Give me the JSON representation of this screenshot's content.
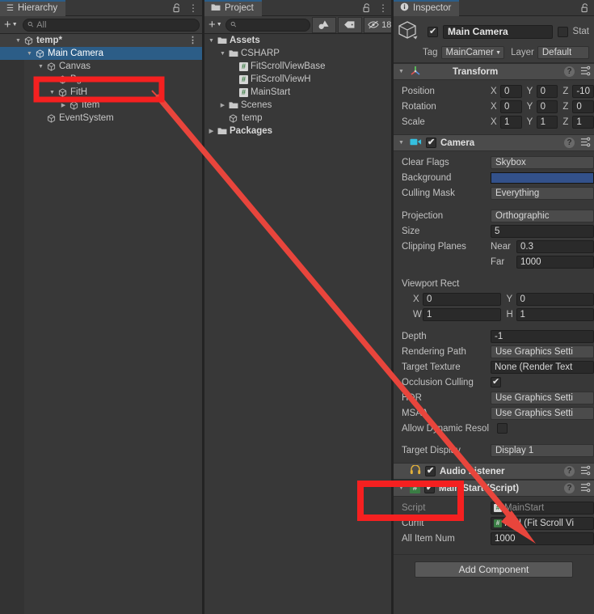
{
  "hierarchy": {
    "tab_label": "Hierarchy",
    "tab_icon": "hierarchy-icon",
    "lock_icon": "lock-open-icon",
    "menu_icon": "kebab-menu-icon",
    "add_label": "+",
    "search_placeholder": "All",
    "scene_name": "temp*",
    "items": [
      {
        "label": "Main Camera",
        "depth": 1,
        "twisty": "open",
        "icon": "gameobject-icon",
        "selected": true
      },
      {
        "label": "Canvas",
        "depth": 2,
        "twisty": "open",
        "icon": "gameobject-icon",
        "selected": false
      },
      {
        "label": "Bg",
        "depth": 3,
        "twisty": "none",
        "icon": "gameobject-icon",
        "selected": false
      },
      {
        "label": "FitH",
        "depth": 3,
        "twisty": "open",
        "icon": "gameobject-icon",
        "selected": false
      },
      {
        "label": "Item",
        "depth": 4,
        "twisty": "closed",
        "icon": "gameobject-icon",
        "selected": false
      },
      {
        "label": "EventSystem",
        "depth": 2,
        "twisty": "none",
        "icon": "gameobject-icon",
        "selected": false
      }
    ]
  },
  "project": {
    "tab_label": "Project",
    "tab_icon": "folder-icon",
    "lock_icon": "lock-open-icon",
    "menu_icon": "kebab-menu-icon",
    "add_label": "+",
    "search_placeholder": "",
    "toolbar_icons": [
      "shapes-filter-icon",
      "label-filter-icon",
      "hidden-count-icon"
    ],
    "hidden_count": "18",
    "items": [
      {
        "label": "Assets",
        "depth": 0,
        "twisty": "open",
        "kind": "folder",
        "bold": true
      },
      {
        "label": "CSHARP",
        "depth": 1,
        "twisty": "open",
        "kind": "folder",
        "bold": false
      },
      {
        "label": "FitScrollViewBase",
        "depth": 2,
        "twisty": "none",
        "kind": "script",
        "bold": false
      },
      {
        "label": "FitScrollViewH",
        "depth": 2,
        "twisty": "none",
        "kind": "script",
        "bold": false
      },
      {
        "label": "MainStart",
        "depth": 2,
        "twisty": "none",
        "kind": "script",
        "bold": false
      },
      {
        "label": "Scenes",
        "depth": 1,
        "twisty": "closed",
        "kind": "folder",
        "bold": false
      },
      {
        "label": "temp",
        "depth": 2,
        "twisty": "none",
        "kind": "scene",
        "bold": false
      },
      {
        "label": "Packages",
        "depth": 0,
        "twisty": "closed",
        "kind": "folder",
        "bold": true
      }
    ]
  },
  "inspector": {
    "tab_label": "Inspector",
    "tab_icon": "info-icon",
    "lock_icon": "lock-open-icon",
    "gameobject": {
      "enabled": true,
      "name": "Main Camera",
      "static_label": "Stat",
      "tag_label": "Tag",
      "tag_value": "MainCamer",
      "layer_label": "Layer",
      "layer_value": "Default"
    },
    "transform": {
      "title": "Transform",
      "icon": "transform-icon",
      "rows": [
        {
          "label": "Position",
          "x": "0",
          "y": "0",
          "z": "-10"
        },
        {
          "label": "Rotation",
          "x": "0",
          "y": "0",
          "z": "0"
        },
        {
          "label": "Scale",
          "x": "1",
          "y": "1",
          "z": "1"
        }
      ]
    },
    "camera": {
      "title": "Camera",
      "icon": "camera-icon",
      "enabled": true,
      "clear_flags_label": "Clear Flags",
      "clear_flags_value": "Skybox",
      "background_label": "Background",
      "background_color": "#33518a",
      "culling_mask_label": "Culling Mask",
      "culling_mask_value": "Everything",
      "projection_label": "Projection",
      "projection_value": "Orthographic",
      "size_label": "Size",
      "size_value": "5",
      "clipping_label": "Clipping Planes",
      "near_label": "Near",
      "near_value": "0.3",
      "far_label": "Far",
      "far_value": "1000",
      "viewport_label": "Viewport Rect",
      "viewport_x_label": "X",
      "viewport_x": "0",
      "viewport_y_label": "Y",
      "viewport_y": "0",
      "viewport_w_label": "W",
      "viewport_w": "1",
      "viewport_h_label": "H",
      "viewport_h": "1",
      "depth_label": "Depth",
      "depth_value": "-1",
      "rendering_path_label": "Rendering Path",
      "rendering_path_value": "Use Graphics Setti",
      "target_texture_label": "Target Texture",
      "target_texture_value": "None (Render Text",
      "occlusion_label": "Occlusion Culling",
      "occlusion_checked": true,
      "hdr_label": "HDR",
      "hdr_value": "Use Graphics Setti",
      "msaa_label": "MSAA",
      "msaa_value": "Use Graphics Setti",
      "dynamic_res_label": "Allow Dynamic Resol",
      "dynamic_res_checked": false,
      "target_display_label": "Target Display",
      "target_display_value": "Display 1"
    },
    "audio_listener": {
      "title": "Audio Listener",
      "icon": "audio-listener-icon",
      "enabled": true
    },
    "main_start": {
      "title": "Main Start (Script)",
      "icon": "script-icon",
      "enabled": true,
      "rows": [
        {
          "label": "Script",
          "value": "MainStart",
          "kind": "object-disabled"
        },
        {
          "label": "Curfit",
          "value": "FitH (Fit Scroll Vi",
          "kind": "object"
        },
        {
          "label": "All Item Num",
          "value": "1000",
          "kind": "text"
        }
      ]
    },
    "add_component_label": "Add Component"
  },
  "annotations": {
    "box_color": "#f52020",
    "arrow_color": "#e8453c",
    "highlight_1": "hierarchy-fith-highlight",
    "highlight_2": "main-start-component-highlight",
    "arrow": "fith-to-curfit-arrow"
  }
}
